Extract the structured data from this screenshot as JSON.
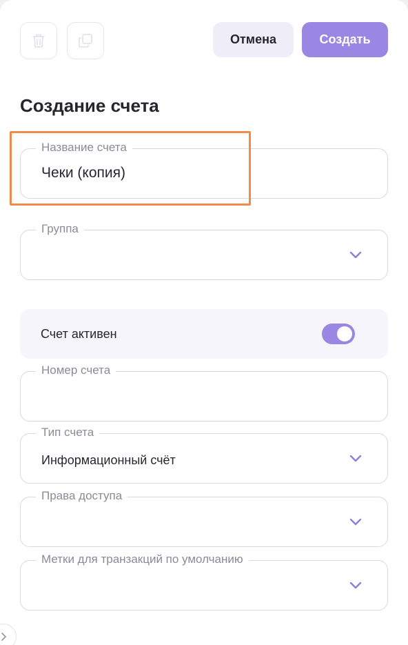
{
  "toolbar": {
    "delete_icon": "trash-icon",
    "copy_icon": "copy-icon",
    "cancel_label": "Отмена",
    "create_label": "Создать"
  },
  "form": {
    "title": "Создание счета",
    "account_name": {
      "label": "Название счета",
      "value": "Чеки (копия)"
    },
    "group": {
      "label": "Группа",
      "value": ""
    },
    "active_toggle": {
      "label": "Счет активен",
      "checked": true
    },
    "account_number": {
      "label": "Номер счета",
      "value": ""
    },
    "account_type": {
      "label": "Тип счета",
      "value": "Информационный счёт"
    },
    "access_rights": {
      "label": "Права доступа",
      "value": ""
    },
    "default_tags": {
      "label": "Метки для транзакций по умолчанию",
      "value": ""
    }
  },
  "colors": {
    "accent": "#9a86e3",
    "highlight": "#f18b4a",
    "text": "#27262e",
    "muted_label": "#8b8a97"
  }
}
